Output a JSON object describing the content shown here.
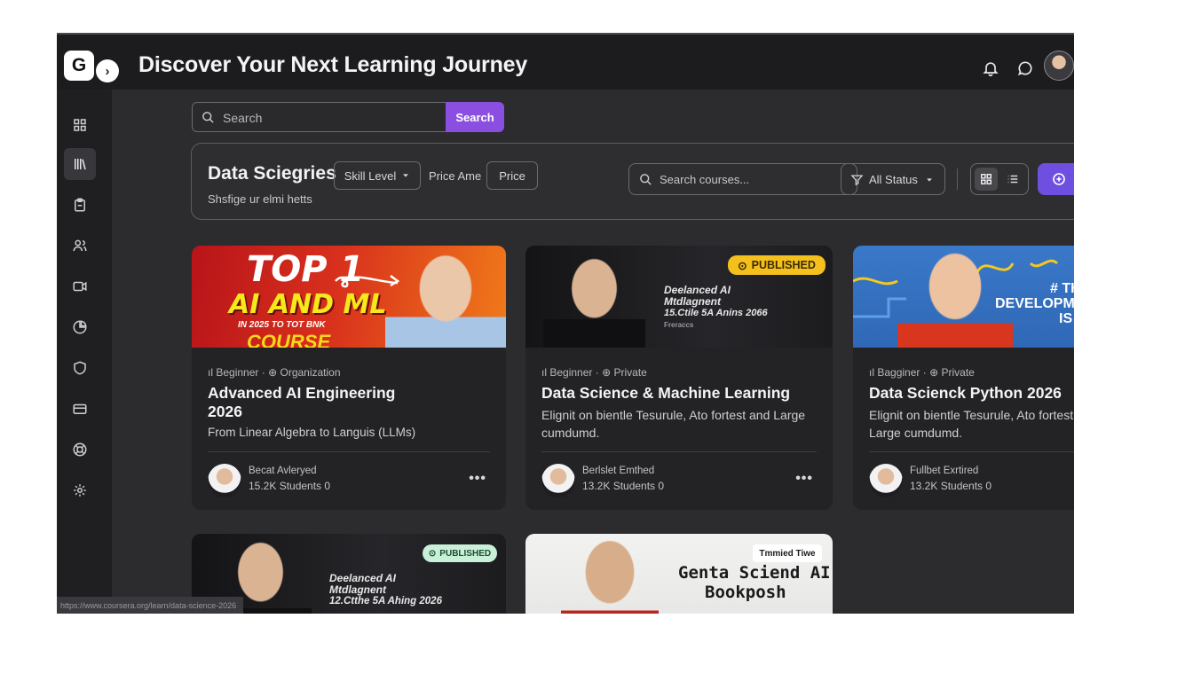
{
  "header": {
    "logo_letter": "G",
    "title": "Discover Your Next Learning Journey",
    "icons": [
      "bell-icon",
      "chat-icon",
      "user-avatar"
    ]
  },
  "sidebar": {
    "items": [
      {
        "icon": "grid-icon"
      },
      {
        "icon": "library-icon",
        "active": true
      },
      {
        "icon": "clipboard-icon"
      },
      {
        "icon": "users-icon"
      },
      {
        "icon": "video-icon"
      },
      {
        "icon": "pie-chart-icon"
      },
      {
        "icon": "shield-icon"
      },
      {
        "icon": "card-icon"
      },
      {
        "icon": "support-icon"
      },
      {
        "icon": "settings-icon"
      }
    ]
  },
  "search": {
    "placeholder": "Search",
    "button": "Search"
  },
  "filters": {
    "title": "Data Sciegries",
    "subtitle": "Shsfige ur elmi hetts",
    "skill_level": "Skill Level",
    "price_label": "Price Ame",
    "price_button": "Price",
    "course_search_placeholder": "Search courses...",
    "status": "All Status"
  },
  "colors": {
    "accent": "#8a4fe0",
    "published_badge": "#f4c01e",
    "published_badge_green": "#c9f0d8"
  },
  "courses": [
    {
      "level": "Beginner",
      "visibility": "Organization",
      "title": "Advanced AI Engineering 2026",
      "description": "From Linear Algebra to Languis (LLMs)",
      "author": "Becat Avleryed",
      "stats": "15.2K Students 0",
      "cover": {
        "line1": "TOP 1",
        "line2": "AI AND ML",
        "line3": "IN 2025 TO TOT BNK",
        "line4": "COURSE"
      }
    },
    {
      "level": "Beginner",
      "visibility": "Private",
      "title": "Data Science & Machine Learning",
      "description": "Elignit on bientle Tesurule, Ato fortest and Large cumdumd.",
      "author": "Berlslet Emthed",
      "stats": "13.2K Students 0",
      "badge": "PUBLISHED",
      "cover": {
        "line1": "Deelanced AI",
        "line2": "Mtdlagnent",
        "line3": "15.Ctile 5A Anins 2066",
        "line4": "Freraccs"
      }
    },
    {
      "level": "Bagginer",
      "visibility": "Private",
      "title": "Data Scienck Python 2026",
      "description": "Elignit on bientle Tesurule, Ato fortest and Large cumdumd.",
      "author": "Fullbet Exrtired",
      "stats": "13.2K Students 0",
      "cover": {
        "line1": "# THE",
        "line2": "DEVELOPME",
        "line3": "IS N"
      }
    },
    {
      "badge": "PUBLISHED",
      "cover": {
        "line1": "Deelanced AI",
        "line2": "Mtdlagnent",
        "line3": "12.Ctthe 5A Ahing 2026"
      }
    },
    {
      "badge": "Tmmied Tiwe",
      "cover": {
        "line1": "Genta Sciend AI",
        "line2": "Bookposh"
      }
    }
  ],
  "status_url": "https://www.coursera.org/learn/data-science-2026"
}
